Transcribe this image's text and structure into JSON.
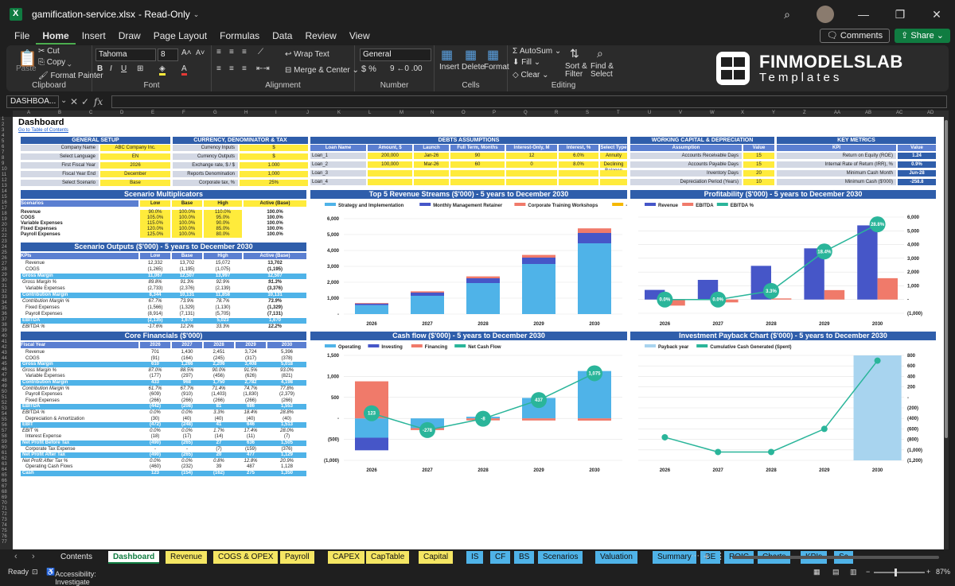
{
  "window": {
    "filename": "gamification-service.xlsx",
    "mode": "Read-Only"
  },
  "menu": {
    "items": [
      "File",
      "Home",
      "Insert",
      "Draw",
      "Page Layout",
      "Formulas",
      "Data",
      "Review",
      "View"
    ],
    "comments": "Comments",
    "share": "Share"
  },
  "ribbon": {
    "paste": "Paste",
    "cut": "Cut",
    "copy": "Copy",
    "format_painter": "Format Painter",
    "clipboard": "Clipboard",
    "font_name": "Tahoma",
    "font_size": "8",
    "font": "Font",
    "wrap": "Wrap Text",
    "merge": "Merge & Center",
    "alignment": "Alignment",
    "number_format": "General",
    "number": "Number",
    "insert": "Insert",
    "delete": "Delete",
    "format": "Format",
    "cells": "Cells",
    "autosum": "AutoSum",
    "fill": "Fill",
    "clear": "Clear",
    "sort": "Sort & Filter",
    "find": "Find & Select",
    "editing": "Editing",
    "logo1": "FINMODELSLAB",
    "logo2": "Templates"
  },
  "formula": {
    "namebox": "DASHBOA...",
    "fx": "fx"
  },
  "sheet": {
    "title": "Dashboard",
    "toc": "Go to Table of Contents",
    "general": {
      "title": "GENERAL SETUP",
      "rows": [
        [
          "Company Name",
          "ABC Company Inc."
        ],
        [
          "Select Language",
          "EN"
        ],
        [
          "First Fiscal Year",
          "2026"
        ],
        [
          "Fiscal Year End",
          "December"
        ],
        [
          "Select Scenario",
          "Base"
        ]
      ]
    },
    "currency": {
      "title": "CURRENCY, DENOMINATOR & TAX",
      "rows": [
        [
          "Currency Inputs",
          "$"
        ],
        [
          "Currency Outputs",
          "$"
        ],
        [
          "Exchange rate, $ / $",
          "1.000"
        ],
        [
          "Reports Denomination",
          "1,000"
        ],
        [
          "Corporate tax, %",
          "25%"
        ]
      ]
    },
    "debts": {
      "title": "DEBTS ASSUMPTIONS",
      "headers": [
        "Loan Name",
        "Amount, $",
        "Launch",
        "Full Term, Months",
        "Interest-Only, M",
        "Interest, %",
        "Select Type"
      ],
      "rows": [
        [
          "Loan_1",
          "200,000",
          "Jan-26",
          "90",
          "12",
          "6.0%",
          "Annuity"
        ],
        [
          "Loan_2",
          "100,000",
          "Mar-26",
          "60",
          "0",
          "8.0%",
          "Declining Balance"
        ],
        [
          "Loan_3",
          "",
          "",
          "",
          "",
          "",
          ""
        ],
        [
          "Loan_4",
          "",
          "",
          "",
          "",
          "",
          ""
        ]
      ]
    },
    "wc": {
      "title": "WORKING CAPITAL & DEPRECIATION",
      "headers": [
        "Assumption",
        "Value"
      ],
      "rows": [
        [
          "Accounts Receivable Days",
          "15"
        ],
        [
          "Accounts Payable Days",
          "15"
        ],
        [
          "Inventory Days",
          "20"
        ],
        [
          "Depreciation Period (Years)",
          "10"
        ]
      ]
    },
    "kpi": {
      "title": "KEY METRICS",
      "headers": [
        "KPI",
        "Value"
      ],
      "rows": [
        [
          "Return on Equity (ROE)",
          "1.24"
        ],
        [
          "Internal Rate of Return (IRR), %",
          "0.9%"
        ],
        [
          "Minimum Cash Month",
          "Jun-28"
        ],
        [
          "Minimum Cash ($'000)",
          "-258.8"
        ]
      ]
    },
    "scen": {
      "title": "Scenario Multiplicators",
      "headers": [
        "Scenarios",
        "Low",
        "Base",
        "High",
        "Active (Base)"
      ],
      "rows": [
        [
          "Revenue",
          "90.0%",
          "100.0%",
          "110.0%",
          "100.0%"
        ],
        [
          "COGS",
          "105.0%",
          "100.0%",
          "95.0%",
          "100.0%"
        ],
        [
          "Variable Expenses",
          "115.0%",
          "100.0%",
          "90.0%",
          "100.0%"
        ],
        [
          "Fixed Expenses",
          "120.0%",
          "100.0%",
          "85.0%",
          "100.0%"
        ],
        [
          "Payroll Expenses",
          "125.0%",
          "100.0%",
          "80.0%",
          "100.0%"
        ]
      ]
    },
    "outputs": {
      "title": "Scenario Outputs ($'000) - 5 years to December 2030",
      "headers": [
        "KPIs",
        "Low",
        "Base",
        "High",
        "Active (Base)"
      ],
      "rows": [
        [
          "Revenue",
          "12,332",
          "13,702",
          "15,072",
          "13,702",
          0
        ],
        [
          "COGS",
          "(1,265)",
          "(1,195)",
          "(1,075)",
          "(1,195)",
          0
        ],
        [
          "Gross Margin",
          "11,067",
          "12,507",
          "13,997",
          "12,507",
          1
        ],
        [
          "Gross Margin %",
          "89.8%",
          "91.3%",
          "92.9%",
          "91.3%",
          2
        ],
        [
          "Variable Expenses",
          "(2,733)",
          "(2,376)",
          "(2,139)",
          "(3,376)",
          0
        ],
        [
          "Contribution Margin",
          "8,344",
          "10,131",
          "11,858",
          "10,131",
          1
        ],
        [
          "Contribution Margin %",
          "67.7%",
          "73.9%",
          "78.7%",
          "73.9%",
          2
        ],
        [
          "Fixed Expenses",
          "(1,566)",
          "(1,329)",
          "(1,130)",
          "(1,329)",
          0
        ],
        [
          "Payroll Expenses",
          "(8,914)",
          "(7,131)",
          "(5,705)",
          "(7,131)",
          0
        ],
        [
          "EBITDA",
          "(2,135)",
          "1,670",
          "5,023",
          "1,670",
          1
        ],
        [
          "EBITDA %",
          "-17.6%",
          "12.2%",
          "33.3%",
          "12.2%",
          2
        ]
      ]
    },
    "core": {
      "title": "Core Financials ($'000)",
      "headers": [
        "Fiscal Year",
        "2026",
        "2027",
        "2028",
        "2029",
        "2030"
      ],
      "rows": [
        [
          "Revenue",
          "701",
          "1,430",
          "2,451",
          "3,724",
          "5,396",
          0
        ],
        [
          "COGS",
          "(91)",
          "(164)",
          "(245)",
          "(317)",
          "(378)",
          0
        ],
        [
          "Gross Margin",
          "610",
          "1,266",
          "2,206",
          "3,408",
          "5,018",
          1
        ],
        [
          "Gross Margin %",
          "87.0%",
          "88.5%",
          "90.0%",
          "91.5%",
          "93.0%",
          2
        ],
        [
          "Variable Expenses",
          "(177)",
          "(297)",
          "(456)",
          "(626)",
          "(821)",
          0
        ],
        [
          "Contribution Margin",
          "433",
          "968",
          "1,750",
          "2,782",
          "4,198",
          1
        ],
        [
          "Contribution Margin %",
          "61.7%",
          "67.7%",
          "71.4%",
          "74.7%",
          "77.8%",
          2
        ],
        [
          "Payroll Expenses",
          "(609)",
          "(910)",
          "(1,403)",
          "(1,830)",
          "(2,379)",
          0
        ],
        [
          "Fixed Expenses",
          "(266)",
          "(266)",
          "(266)",
          "(266)",
          "(266)",
          0
        ],
        [
          "EBITDA",
          "(442)",
          "(208)",
          "81",
          "686",
          "1,553",
          1
        ],
        [
          "EBITDA %",
          "0.0%",
          "0.0%",
          "3.3%",
          "18.4%",
          "28.8%",
          2
        ],
        [
          "Depreciation & Amortization",
          "(30)",
          "(40)",
          "(40)",
          "(40)",
          "(40)",
          0
        ],
        [
          "EBIT",
          "(472)",
          "(248)",
          "41",
          "646",
          "1,513",
          1
        ],
        [
          "EBIT %",
          "0.0%",
          "0.0%",
          "1.7%",
          "17.4%",
          "28.0%",
          2
        ],
        [
          "Interest Expense",
          "(18)",
          "(17)",
          "(14)",
          "(11)",
          "(7)",
          0
        ],
        [
          "Net Profit Before Tax",
          "(490)",
          "(265)",
          "27",
          "636",
          "1,505",
          1
        ],
        [
          "Corporate Tax Expense",
          "-",
          "-",
          "(7)",
          "(159)",
          "(376)",
          0
        ],
        [
          "Net Profit After Tax",
          "(490)",
          "(265)",
          "20",
          "477",
          "1,129",
          1
        ],
        [
          "Net Profit After Tax %",
          "0.0%",
          "0.0%",
          "0.8%",
          "12.8%",
          "20.9%",
          2
        ],
        [
          "Operating Cash Flows",
          "(460)",
          "(232)",
          "39",
          "487",
          "1,128",
          0
        ],
        [
          "Cash",
          "123",
          "(154)",
          "(162)",
          "275",
          "1,350",
          1
        ]
      ]
    }
  },
  "charts": [
    {
      "title": "Top 5 Revenue Streams ($'000) - 5 years to December 2030",
      "type": "bar",
      "categories": [
        "2026",
        "2027",
        "2028",
        "2029",
        "2030"
      ],
      "series": [
        {
          "name": "Strategy and Implementation",
          "values": [
            560,
            1150,
            1950,
            3150,
            4450
          ],
          "color": "#4fb3e8"
        },
        {
          "name": "Monthly Management Retainer",
          "values": [
            100,
            200,
            300,
            400,
            650
          ],
          "color": "#4656c8"
        },
        {
          "name": "Corporate Training Workshops",
          "values": [
            40,
            80,
            120,
            170,
            290
          ],
          "color": "#f07a6a"
        },
        {
          "name": "-",
          "values": [
            0,
            0,
            0,
            0,
            0
          ],
          "color": "#f5b800"
        },
        {
          "name": "Other Revenue",
          "values": [
            0,
            0,
            0,
            0,
            0
          ],
          "color": "#2ab59a"
        }
      ],
      "ylim": [
        0,
        6000
      ],
      "yticks": [
        "-",
        "1,000",
        "2,000",
        "3,000",
        "4,000",
        "5,000",
        "6,000"
      ]
    },
    {
      "title": "Profitability ($'000) - 5 years to December 2030",
      "type": "bar",
      "categories": [
        "2026",
        "2027",
        "2028",
        "2029",
        "2030"
      ],
      "series": [
        {
          "name": "Revenue",
          "values": [
            701,
            1430,
            2451,
            3724,
            5396
          ],
          "color": "#4656c8"
        },
        {
          "name": "EBITDA",
          "values": [
            -442,
            -208,
            81,
            686,
            1553
          ],
          "color": "#f07a6a"
        },
        {
          "name": "EBITDA %",
          "values": [
            0.0,
            0.0,
            3.3,
            18.4,
            28.8
          ],
          "color": "#2ab59a",
          "labels": [
            "0.0%",
            "0.0%",
            "3.3%",
            "18.4%",
            "28.8%"
          ]
        }
      ],
      "ylim": [
        -1000,
        6000
      ],
      "yticks": [
        "(1,000)",
        "-",
        "1,000",
        "2,000",
        "3,000",
        "4,000",
        "5,000",
        "6,000"
      ]
    },
    {
      "title": "Cash flow ($'000) - 5 years to December 2030",
      "type": "bar",
      "categories": [
        "2026",
        "2027",
        "2028",
        "2029",
        "2030"
      ],
      "series": [
        {
          "name": "Operating",
          "values": [
            -460,
            -232,
            39,
            487,
            1128
          ],
          "color": "#4fb3e8"
        },
        {
          "name": "Investing",
          "values": [
            -300,
            0,
            0,
            0,
            0
          ],
          "color": "#4656c8"
        },
        {
          "name": "Financing",
          "values": [
            883,
            -46,
            -47,
            -50,
            -53
          ],
          "color": "#f07a6a"
        },
        {
          "name": "Net Cash Flow",
          "values": [
            123,
            -278,
            -8,
            437,
            1075
          ],
          "color": "#2ab59a"
        }
      ],
      "ylim": [
        -1000,
        1500
      ],
      "yticks": [
        "(1,000)",
        "(500)",
        "-",
        "500",
        "1,000",
        "1,500"
      ]
    },
    {
      "title": "Investment Payback Chart ($'000) - 5 years to December 2030",
      "type": "line",
      "categories": [
        "2026",
        "2027",
        "2028",
        "2029",
        "2030"
      ],
      "series": [
        {
          "name": "Payback year",
          "values": [
            0,
            0,
            0,
            0,
            1
          ],
          "color": "#a8d4ef"
        },
        {
          "name": "Cumulative Cash Generated (Spent)",
          "values": [
            -760,
            -1040,
            -1040,
            -600,
            700
          ],
          "color": "#2ab59a"
        }
      ],
      "ylim": [
        -1200,
        800
      ],
      "yticks": [
        "(1,200)",
        "(1,000)",
        "(800)",
        "(600)",
        "(400)",
        "(200)",
        "-",
        "200",
        "400",
        "600",
        "800"
      ]
    }
  ],
  "tabs": [
    {
      "label": "Contents",
      "bg": "#1f1f1f",
      "fg": "#e8e8e8"
    },
    {
      "label": "Dashboard",
      "bg": "#ffffff",
      "fg": "#107c41"
    },
    {
      "label": "Revenue",
      "bg": "#f5e663",
      "fg": "#111"
    },
    {
      "label": "COGS & OPEX",
      "bg": "#f5e663",
      "fg": "#111"
    },
    {
      "label": "Payroll",
      "bg": "#f5e663",
      "fg": "#111"
    },
    {
      "label": "CAPEX",
      "bg": "#f5e663",
      "fg": "#111"
    },
    {
      "label": "CapTable",
      "bg": "#f5e663",
      "fg": "#111"
    },
    {
      "label": "Capital",
      "bg": "#f5e663",
      "fg": "#111"
    },
    {
      "label": "IS",
      "bg": "#4fb3e8",
      "fg": "#111"
    },
    {
      "label": "CF",
      "bg": "#4fb3e8",
      "fg": "#111"
    },
    {
      "label": "BS",
      "bg": "#4fb3e8",
      "fg": "#111"
    },
    {
      "label": "Scenarios",
      "bg": "#4fb3e8",
      "fg": "#111"
    },
    {
      "label": "Valuation",
      "bg": "#4fb3e8",
      "fg": "#111"
    },
    {
      "label": "Summary",
      "bg": "#4fb3e8",
      "fg": "#111"
    },
    {
      "label": "BE",
      "bg": "#4fb3e8",
      "fg": "#111"
    },
    {
      "label": "ROIC",
      "bg": "#4fb3e8",
      "fg": "#111"
    },
    {
      "label": "Charts",
      "bg": "#4fb3e8",
      "fg": "#111"
    },
    {
      "label": "KPIs",
      "bg": "#4fb3e8",
      "fg": "#111"
    },
    {
      "label": "Sc",
      "bg": "#4fb3e8",
      "fg": "#111"
    }
  ],
  "status": {
    "ready": "Ready",
    "accessibility": "Accessibility: Investigate",
    "zoom": "87%"
  }
}
